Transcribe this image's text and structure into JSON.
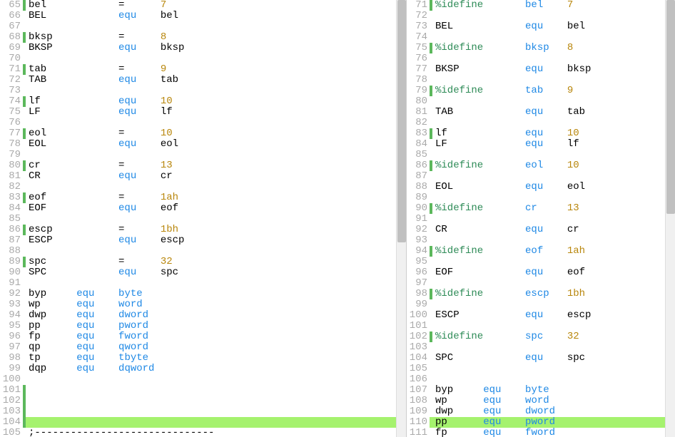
{
  "left": {
    "lines": [
      {
        "n": 65,
        "m": "green",
        "t": [
          [
            "ident",
            "bel            "
          ],
          [
            "op",
            "= "
          ],
          [
            "ident",
            "     "
          ],
          [
            "num",
            "7"
          ]
        ]
      },
      {
        "n": 66,
        "m": "",
        "t": [
          [
            "ident",
            "BEL            "
          ],
          [
            "kw-equ",
            "equ"
          ],
          [
            "ident",
            "    bel"
          ]
        ]
      },
      {
        "n": 67,
        "m": "",
        "t": []
      },
      {
        "n": 68,
        "m": "green",
        "t": [
          [
            "ident",
            "bksp           "
          ],
          [
            "op",
            "= "
          ],
          [
            "ident",
            "     "
          ],
          [
            "num",
            "8"
          ]
        ]
      },
      {
        "n": 69,
        "m": "",
        "t": [
          [
            "ident",
            "BKSP           "
          ],
          [
            "kw-equ",
            "equ"
          ],
          [
            "ident",
            "    bksp"
          ]
        ]
      },
      {
        "n": 70,
        "m": "",
        "t": []
      },
      {
        "n": 71,
        "m": "green",
        "t": [
          [
            "ident",
            "tab            "
          ],
          [
            "op",
            "= "
          ],
          [
            "ident",
            "     "
          ],
          [
            "num",
            "9"
          ]
        ]
      },
      {
        "n": 72,
        "m": "",
        "t": [
          [
            "ident",
            "TAB            "
          ],
          [
            "kw-equ",
            "equ"
          ],
          [
            "ident",
            "    tab"
          ]
        ]
      },
      {
        "n": 73,
        "m": "",
        "t": []
      },
      {
        "n": 74,
        "m": "green",
        "t": [
          [
            "ident",
            "lf             "
          ],
          [
            "kw-equ",
            "equ"
          ],
          [
            "ident",
            "    "
          ],
          [
            "num",
            "10"
          ]
        ]
      },
      {
        "n": 75,
        "m": "",
        "t": [
          [
            "ident",
            "LF             "
          ],
          [
            "kw-equ",
            "equ"
          ],
          [
            "ident",
            "    lf"
          ]
        ]
      },
      {
        "n": 76,
        "m": "",
        "t": []
      },
      {
        "n": 77,
        "m": "green",
        "t": [
          [
            "ident",
            "eol            "
          ],
          [
            "op",
            "= "
          ],
          [
            "ident",
            "     "
          ],
          [
            "num",
            "10"
          ]
        ]
      },
      {
        "n": 78,
        "m": "",
        "t": [
          [
            "ident",
            "EOL            "
          ],
          [
            "kw-equ",
            "equ"
          ],
          [
            "ident",
            "    eol"
          ]
        ]
      },
      {
        "n": 79,
        "m": "",
        "t": []
      },
      {
        "n": 80,
        "m": "green",
        "t": [
          [
            "ident",
            "cr             "
          ],
          [
            "op",
            "= "
          ],
          [
            "ident",
            "     "
          ],
          [
            "num",
            "13"
          ]
        ]
      },
      {
        "n": 81,
        "m": "",
        "t": [
          [
            "ident",
            "CR             "
          ],
          [
            "kw-equ",
            "equ"
          ],
          [
            "ident",
            "    cr"
          ]
        ]
      },
      {
        "n": 82,
        "m": "",
        "t": []
      },
      {
        "n": 83,
        "m": "green",
        "t": [
          [
            "ident",
            "eof            "
          ],
          [
            "op",
            "= "
          ],
          [
            "ident",
            "     "
          ],
          [
            "num",
            "1ah"
          ]
        ]
      },
      {
        "n": 84,
        "m": "",
        "t": [
          [
            "ident",
            "EOF            "
          ],
          [
            "kw-equ",
            "equ"
          ],
          [
            "ident",
            "    eof"
          ]
        ]
      },
      {
        "n": 85,
        "m": "",
        "t": []
      },
      {
        "n": 86,
        "m": "green",
        "t": [
          [
            "ident",
            "escp           "
          ],
          [
            "op",
            "= "
          ],
          [
            "ident",
            "     "
          ],
          [
            "num",
            "1bh"
          ]
        ]
      },
      {
        "n": 87,
        "m": "",
        "t": [
          [
            "ident",
            "ESCP           "
          ],
          [
            "kw-equ",
            "equ"
          ],
          [
            "ident",
            "    escp"
          ]
        ]
      },
      {
        "n": 88,
        "m": "",
        "t": []
      },
      {
        "n": 89,
        "m": "green",
        "t": [
          [
            "ident",
            "spc            "
          ],
          [
            "op",
            "= "
          ],
          [
            "ident",
            "     "
          ],
          [
            "num",
            "32"
          ]
        ]
      },
      {
        "n": 90,
        "m": "",
        "t": [
          [
            "ident",
            "SPC            "
          ],
          [
            "kw-equ",
            "equ"
          ],
          [
            "ident",
            "    spc"
          ]
        ]
      },
      {
        "n": 91,
        "m": "",
        "t": []
      },
      {
        "n": 92,
        "m": "",
        "t": [
          [
            "ident",
            "byp     "
          ],
          [
            "kw-equ",
            "equ"
          ],
          [
            "ident",
            "    "
          ],
          [
            "kw-type",
            "byte"
          ]
        ]
      },
      {
        "n": 93,
        "m": "",
        "t": [
          [
            "ident",
            "wp      "
          ],
          [
            "kw-equ",
            "equ"
          ],
          [
            "ident",
            "    "
          ],
          [
            "kw-type",
            "word"
          ]
        ]
      },
      {
        "n": 94,
        "m": "",
        "t": [
          [
            "ident",
            "dwp     "
          ],
          [
            "kw-equ",
            "equ"
          ],
          [
            "ident",
            "    "
          ],
          [
            "kw-type",
            "dword"
          ]
        ]
      },
      {
        "n": 95,
        "m": "",
        "t": [
          [
            "ident",
            "pp      "
          ],
          [
            "kw-equ",
            "equ"
          ],
          [
            "ident",
            "    "
          ],
          [
            "kw-type",
            "pword"
          ]
        ]
      },
      {
        "n": 96,
        "m": "",
        "t": [
          [
            "ident",
            "fp      "
          ],
          [
            "kw-equ",
            "equ"
          ],
          [
            "ident",
            "    "
          ],
          [
            "kw-type",
            "fword"
          ]
        ]
      },
      {
        "n": 97,
        "m": "",
        "t": [
          [
            "ident",
            "qp      "
          ],
          [
            "kw-equ",
            "equ"
          ],
          [
            "ident",
            "    "
          ],
          [
            "kw-type",
            "qword"
          ]
        ]
      },
      {
        "n": 98,
        "m": "",
        "t": [
          [
            "ident",
            "tp      "
          ],
          [
            "kw-equ",
            "equ"
          ],
          [
            "ident",
            "    "
          ],
          [
            "kw-type",
            "tbyte"
          ]
        ]
      },
      {
        "n": 99,
        "m": "",
        "t": [
          [
            "ident",
            "dqp     "
          ],
          [
            "kw-equ",
            "equ"
          ],
          [
            "ident",
            "    "
          ],
          [
            "kw-type",
            "dqword"
          ]
        ]
      },
      {
        "n": 100,
        "m": "",
        "t": []
      },
      {
        "n": 101,
        "m": "green",
        "t": []
      },
      {
        "n": 102,
        "m": "green",
        "t": []
      },
      {
        "n": 103,
        "m": "green",
        "t": []
      },
      {
        "n": 104,
        "m": "green",
        "hl": true,
        "t": []
      },
      {
        "n": 105,
        "m": "",
        "t": [
          [
            "ident",
            ";------------------------------"
          ]
        ]
      }
    ]
  },
  "right": {
    "lines": [
      {
        "n": 71,
        "m": "green",
        "t": [
          [
            "kw-idef",
            "%idefine"
          ],
          [
            "ident",
            "       "
          ],
          [
            "kw-type",
            "bel"
          ],
          [
            "ident",
            "    "
          ],
          [
            "num",
            "7"
          ]
        ]
      },
      {
        "n": 72,
        "m": "",
        "t": []
      },
      {
        "n": 73,
        "m": "",
        "t": [
          [
            "ident",
            "BEL            "
          ],
          [
            "kw-equ",
            "equ"
          ],
          [
            "ident",
            "    bel"
          ]
        ]
      },
      {
        "n": 74,
        "m": "",
        "t": []
      },
      {
        "n": 75,
        "m": "green",
        "t": [
          [
            "kw-idef",
            "%idefine"
          ],
          [
            "ident",
            "       "
          ],
          [
            "kw-type",
            "bksp"
          ],
          [
            "ident",
            "   "
          ],
          [
            "num",
            "8"
          ]
        ]
      },
      {
        "n": 76,
        "m": "",
        "t": []
      },
      {
        "n": 77,
        "m": "",
        "t": [
          [
            "ident",
            "BKSP           "
          ],
          [
            "kw-equ",
            "equ"
          ],
          [
            "ident",
            "    bksp"
          ]
        ]
      },
      {
        "n": 78,
        "m": "",
        "t": []
      },
      {
        "n": 79,
        "m": "green",
        "t": [
          [
            "kw-idef",
            "%idefine"
          ],
          [
            "ident",
            "       "
          ],
          [
            "kw-type",
            "tab"
          ],
          [
            "ident",
            "    "
          ],
          [
            "num",
            "9"
          ]
        ]
      },
      {
        "n": 80,
        "m": "",
        "t": []
      },
      {
        "n": 81,
        "m": "",
        "t": [
          [
            "ident",
            "TAB            "
          ],
          [
            "kw-equ",
            "equ"
          ],
          [
            "ident",
            "    tab"
          ]
        ]
      },
      {
        "n": 82,
        "m": "",
        "t": []
      },
      {
        "n": 83,
        "m": "green",
        "t": [
          [
            "ident",
            "lf             "
          ],
          [
            "kw-equ",
            "equ"
          ],
          [
            "ident",
            "    "
          ],
          [
            "num",
            "10"
          ]
        ]
      },
      {
        "n": 84,
        "m": "",
        "t": [
          [
            "ident",
            "LF             "
          ],
          [
            "kw-equ",
            "equ"
          ],
          [
            "ident",
            "    lf"
          ]
        ]
      },
      {
        "n": 85,
        "m": "",
        "t": []
      },
      {
        "n": 86,
        "m": "green",
        "t": [
          [
            "kw-idef",
            "%idefine"
          ],
          [
            "ident",
            "       "
          ],
          [
            "kw-type",
            "eol"
          ],
          [
            "ident",
            "    "
          ],
          [
            "num",
            "10"
          ]
        ]
      },
      {
        "n": 87,
        "m": "",
        "t": []
      },
      {
        "n": 88,
        "m": "",
        "t": [
          [
            "ident",
            "EOL            "
          ],
          [
            "kw-equ",
            "equ"
          ],
          [
            "ident",
            "    eol"
          ]
        ]
      },
      {
        "n": 89,
        "m": "",
        "t": []
      },
      {
        "n": 90,
        "m": "green",
        "t": [
          [
            "kw-idef",
            "%idefine"
          ],
          [
            "ident",
            "       "
          ],
          [
            "kw-type",
            "cr"
          ],
          [
            "ident",
            "     "
          ],
          [
            "num",
            "13"
          ]
        ]
      },
      {
        "n": 91,
        "m": "",
        "t": []
      },
      {
        "n": 92,
        "m": "",
        "t": [
          [
            "ident",
            "CR             "
          ],
          [
            "kw-equ",
            "equ"
          ],
          [
            "ident",
            "    cr"
          ]
        ]
      },
      {
        "n": 93,
        "m": "",
        "t": []
      },
      {
        "n": 94,
        "m": "green",
        "t": [
          [
            "kw-idef",
            "%idefine"
          ],
          [
            "ident",
            "       "
          ],
          [
            "kw-type",
            "eof"
          ],
          [
            "ident",
            "    "
          ],
          [
            "num",
            "1ah"
          ]
        ]
      },
      {
        "n": 95,
        "m": "",
        "t": []
      },
      {
        "n": 96,
        "m": "",
        "t": [
          [
            "ident",
            "EOF            "
          ],
          [
            "kw-equ",
            "equ"
          ],
          [
            "ident",
            "    eof"
          ]
        ]
      },
      {
        "n": 97,
        "m": "",
        "t": []
      },
      {
        "n": 98,
        "m": "green",
        "t": [
          [
            "kw-idef",
            "%idefine"
          ],
          [
            "ident",
            "       "
          ],
          [
            "kw-type",
            "escp"
          ],
          [
            "ident",
            "   "
          ],
          [
            "num",
            "1bh"
          ]
        ]
      },
      {
        "n": 99,
        "m": "",
        "t": []
      },
      {
        "n": 100,
        "m": "",
        "t": [
          [
            "ident",
            "ESCP           "
          ],
          [
            "kw-equ",
            "equ"
          ],
          [
            "ident",
            "    escp"
          ]
        ]
      },
      {
        "n": 101,
        "m": "",
        "t": []
      },
      {
        "n": 102,
        "m": "green",
        "t": [
          [
            "kw-idef",
            "%idefine"
          ],
          [
            "ident",
            "       "
          ],
          [
            "kw-type",
            "spc"
          ],
          [
            "ident",
            "    "
          ],
          [
            "num",
            "32"
          ]
        ]
      },
      {
        "n": 103,
        "m": "",
        "t": []
      },
      {
        "n": 104,
        "m": "",
        "t": [
          [
            "ident",
            "SPC            "
          ],
          [
            "kw-equ",
            "equ"
          ],
          [
            "ident",
            "    spc"
          ]
        ]
      },
      {
        "n": 105,
        "m": "",
        "t": []
      },
      {
        "n": 106,
        "m": "",
        "t": []
      },
      {
        "n": 107,
        "m": "",
        "t": [
          [
            "ident",
            "byp     "
          ],
          [
            "kw-equ",
            "equ"
          ],
          [
            "ident",
            "    "
          ],
          [
            "kw-type",
            "byte"
          ]
        ]
      },
      {
        "n": 108,
        "m": "",
        "t": [
          [
            "ident",
            "wp      "
          ],
          [
            "kw-equ",
            "equ"
          ],
          [
            "ident",
            "    "
          ],
          [
            "kw-type",
            "word"
          ]
        ]
      },
      {
        "n": 109,
        "m": "",
        "t": [
          [
            "ident",
            "dwp     "
          ],
          [
            "kw-equ",
            "equ"
          ],
          [
            "ident",
            "    "
          ],
          [
            "kw-type",
            "dword"
          ]
        ]
      },
      {
        "n": 110,
        "m": "",
        "hl": true,
        "t": [
          [
            "ident",
            "pp      "
          ],
          [
            "kw-equ",
            "equ"
          ],
          [
            "ident",
            "    "
          ],
          [
            "kw-type",
            "pword"
          ]
        ]
      },
      {
        "n": 111,
        "m": "",
        "t": [
          [
            "ident",
            "fp      "
          ],
          [
            "kw-equ",
            "equ"
          ],
          [
            "ident",
            "    "
          ],
          [
            "kw-type",
            "fword"
          ]
        ]
      }
    ]
  }
}
